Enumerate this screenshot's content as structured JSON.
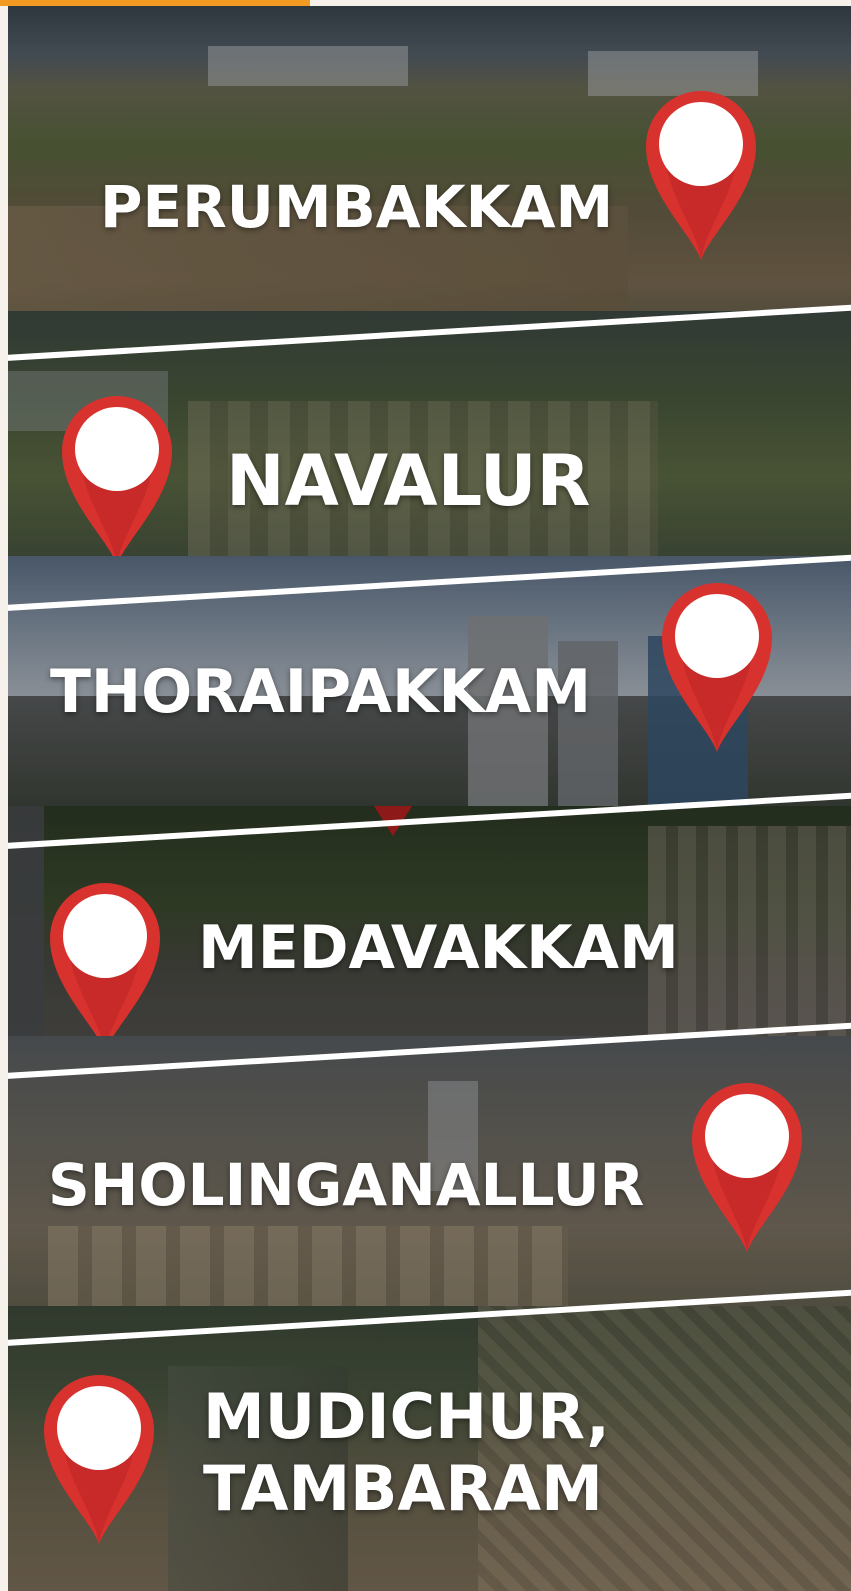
{
  "colors": {
    "accent_bar": "#f29a21",
    "pin_red": "#d8322e",
    "pin_dark": "#a81e1c",
    "divider": "#ffffff",
    "label_text": "#ffffff"
  },
  "locations": [
    {
      "name": "PERUMBAKKAM",
      "icon": "map-pin-icon"
    },
    {
      "name": "NAVALUR",
      "icon": "map-pin-icon"
    },
    {
      "name": "THORAIPAKKAM",
      "icon": "map-pin-icon"
    },
    {
      "name": "MEDAVAKKAM",
      "icon": "map-pin-icon"
    },
    {
      "name": "SHOLINGANALLUR",
      "icon": "map-pin-icon"
    },
    {
      "name_line1": "MUDICHUR,",
      "name_line2": "TAMBARAM",
      "icon": "map-pin-icon"
    }
  ]
}
